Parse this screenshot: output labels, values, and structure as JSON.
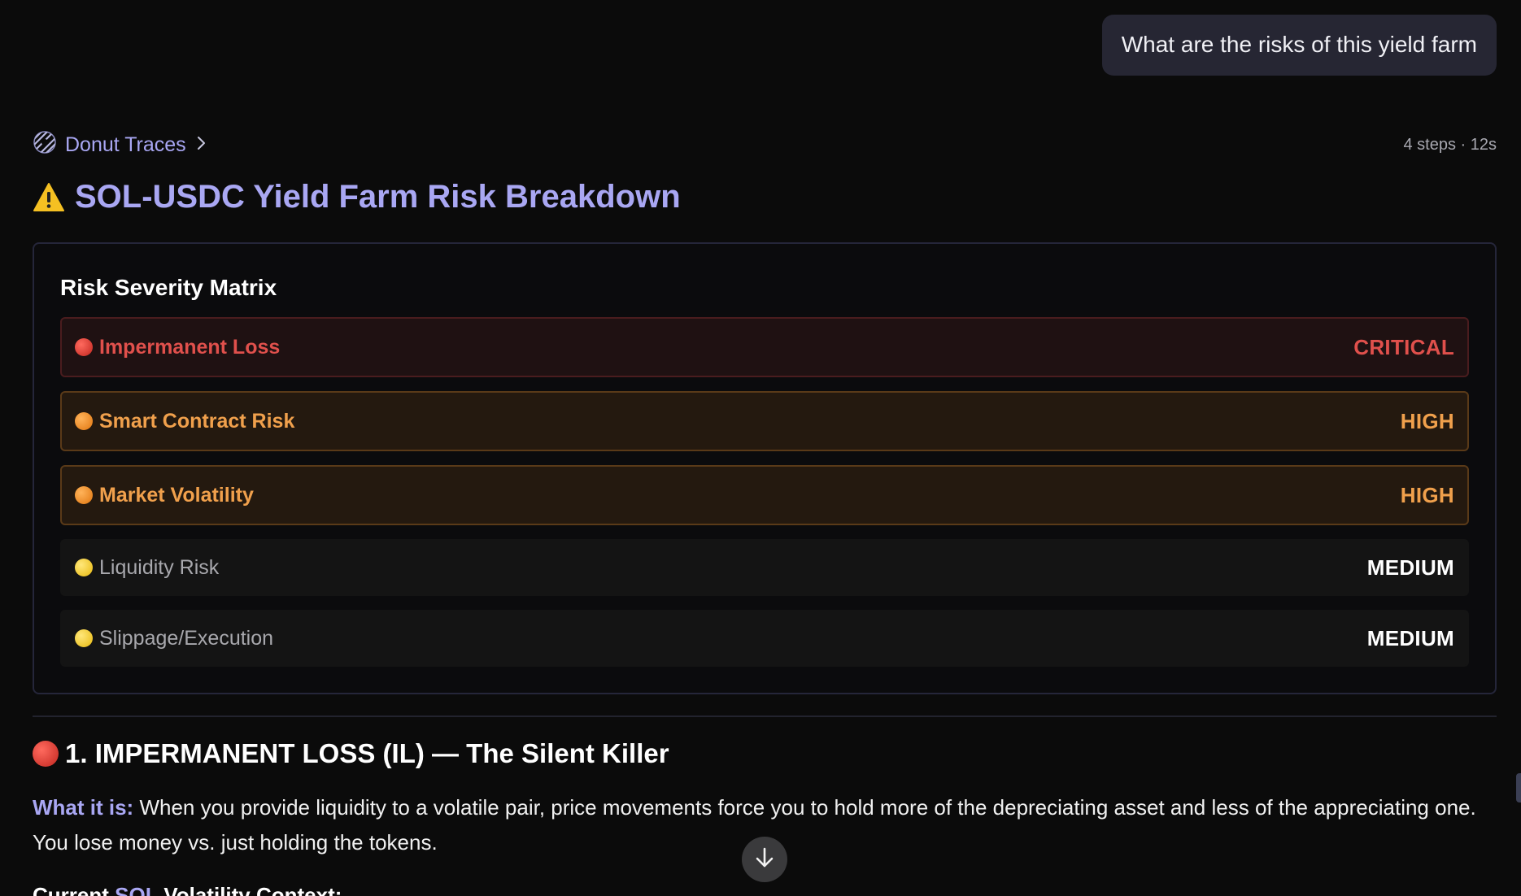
{
  "user_message": {
    "text": "What are the risks of this yield farm"
  },
  "trace": {
    "label": "Donut Traces",
    "meta": "4 steps · 12s"
  },
  "title": {
    "text": "SOL-USDC Yield Farm Risk Breakdown",
    "icon": "warning-icon"
  },
  "matrix": {
    "title": "Risk Severity Matrix",
    "rows": [
      {
        "name": "Impermanent Loss",
        "level": "CRITICAL",
        "severity": "critical",
        "dot_color": "#d8342f"
      },
      {
        "name": "Smart Contract Risk",
        "level": "HIGH",
        "severity": "high",
        "dot_color": "#f08a1c"
      },
      {
        "name": "Market Volatility",
        "level": "HIGH",
        "severity": "high",
        "dot_color": "#f08a1c"
      },
      {
        "name": "Liquidity Risk",
        "level": "MEDIUM",
        "severity": "medium",
        "dot_color": "#f6d23a"
      },
      {
        "name": "Slippage/Execution",
        "level": "MEDIUM",
        "severity": "medium",
        "dot_color": "#f6d23a"
      }
    ]
  },
  "section1": {
    "heading": "1. IMPERMANENT LOSS (IL) — The Silent Killer",
    "what_label": "What it is:",
    "what_text": " When you provide liquidity to a volatile pair, price movements force you to hold more of the depreciating asset and less of the appreciating one. You lose money vs. just holding the tokens.",
    "next_prefix": "Current ",
    "next_accent": "SOL",
    "next_suffix": " Volatility Context:"
  },
  "colors": {
    "accent": "#a9a7f3",
    "critical": "#e0504c",
    "high": "#f0a04c",
    "background": "#0b0b0b"
  }
}
